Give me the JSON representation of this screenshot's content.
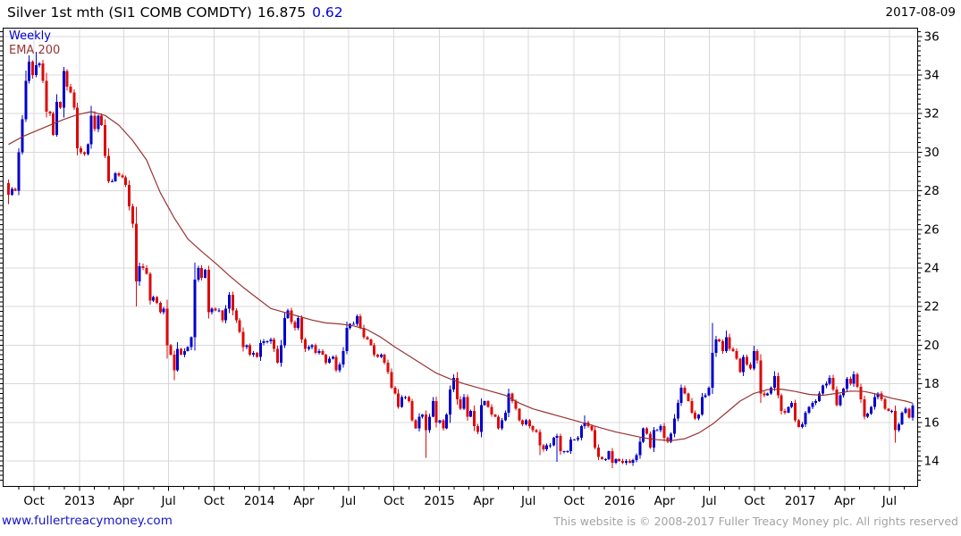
{
  "header": {
    "title": "Silver 1st mth (SI1 COMB COMDTY)",
    "price": "16.875",
    "change": "0.62",
    "date": "2017-08-09"
  },
  "legend": {
    "timeframe": "Weekly",
    "overlay": "EMA 200"
  },
  "footer": {
    "site": "www.fullertreacymoney.com",
    "copyright": "This website is © 2008-2017 Fuller Treacy Money plc. All rights reserved"
  },
  "colors": {
    "up": "#0000cc",
    "down": "#dd0a0a",
    "ema": "#993333",
    "grid": "#d8d8d8",
    "axis": "#000000",
    "text": "#000000",
    "change": "#0000dd",
    "link": "#1414cc",
    "muted": "#a3a3a3"
  },
  "chart_data": {
    "type": "candlestick",
    "timeframe": "Weekly",
    "instrument": "Silver 1st mth (SI1 COMB COMDTY)",
    "overlay": "EMA 200",
    "last": 16.875,
    "change": 0.62,
    "date": "2017-08-09",
    "ylim": [
      12.68,
      36.43
    ],
    "y_ticks": [
      14,
      16,
      18,
      20,
      22,
      24,
      26,
      28,
      30,
      32,
      34,
      36
    ],
    "x_ticks": [
      {
        "label": "Oct",
        "week": 7.4
      },
      {
        "label": "2013",
        "week": 20.6
      },
      {
        "label": "Apr",
        "week": 33.4
      },
      {
        "label": "Jul",
        "week": 46.4
      },
      {
        "label": "Oct",
        "week": 59.6
      },
      {
        "label": "2014",
        "week": 72.7
      },
      {
        "label": "Apr",
        "week": 85.6
      },
      {
        "label": "Jul",
        "week": 98.6
      },
      {
        "label": "Oct",
        "week": 111.7
      },
      {
        "label": "2015",
        "week": 124.9
      },
      {
        "label": "Apr",
        "week": 137.7
      },
      {
        "label": "Jul",
        "week": 150.7
      },
      {
        "label": "Oct",
        "week": 163.9
      },
      {
        "label": "2016",
        "week": 177.1
      },
      {
        "label": "Apr",
        "week": 190.1
      },
      {
        "label": "Jul",
        "week": 203.1
      },
      {
        "label": "Oct",
        "week": 216.2
      },
      {
        "label": "2017",
        "week": 229.4
      },
      {
        "label": "Apr",
        "week": 242.3
      },
      {
        "label": "Jul",
        "week": 255.3
      }
    ],
    "first_open": 28.4,
    "weekly_closes": [
      27.8,
      28.1,
      28.0,
      30.0,
      31.7,
      33.7,
      34.7,
      34.0,
      34.5,
      34.6,
      33.7,
      32.1,
      32.0,
      30.9,
      32.6,
      32.3,
      34.2,
      33.4,
      33.1,
      32.3,
      30.2,
      30.0,
      29.9,
      30.4,
      31.9,
      31.2,
      31.9,
      31.4,
      29.8,
      28.5,
      28.5,
      28.9,
      28.8,
      28.7,
      28.3,
      27.2,
      26.3,
      23.3,
      24.1,
      24.0,
      23.7,
      22.3,
      22.5,
      22.2,
      21.7,
      21.9,
      20.0,
      19.5,
      18.7,
      19.8,
      19.5,
      19.7,
      19.9,
      20.4,
      23.4,
      24.0,
      23.5,
      23.9,
      21.7,
      21.9,
      21.8,
      21.8,
      21.3,
      21.9,
      22.6,
      21.8,
      21.3,
      20.7,
      19.9,
      20.0,
      19.5,
      19.6,
      19.4,
      20.1,
      20.2,
      20.2,
      20.3,
      19.8,
      19.1,
      20.0,
      21.4,
      21.8,
      21.2,
      20.9,
      21.4,
      20.3,
      19.8,
      19.9,
      20.0,
      19.6,
      19.7,
      19.5,
      19.1,
      19.3,
      19.4,
      18.7,
      19.0,
      19.7,
      20.9,
      21.1,
      21.1,
      21.5,
      20.9,
      20.4,
      20.3,
      20.0,
      19.5,
      19.4,
      19.5,
      19.1,
      18.6,
      17.8,
      17.5,
      16.8,
      17.3,
      17.3,
      17.1,
      16.1,
      15.7,
      16.3,
      16.4,
      15.6,
      16.3,
      17.1,
      16.0,
      16.1,
      15.7,
      16.4,
      17.7,
      18.3,
      17.2,
      16.7,
      17.3,
      16.3,
      16.6,
      15.8,
      15.5,
      16.9,
      17.1,
      16.8,
      16.4,
      16.3,
      15.7,
      16.1,
      16.5,
      17.5,
      17.1,
      16.7,
      16.1,
      15.9,
      16.1,
      15.8,
      15.6,
      15.5,
      14.8,
      14.6,
      14.8,
      14.8,
      15.2,
      15.3,
      14.5,
      14.5,
      14.5,
      15.1,
      15.1,
      15.2,
      15.8,
      16.0,
      15.8,
      15.6,
      14.7,
      14.2,
      14.1,
      14.1,
      14.5,
      13.9,
      14.1,
      14.0,
      13.9,
      14.0,
      13.9,
      14.05,
      14.3,
      15.0,
      15.7,
      15.4,
      14.7,
      15.6,
      15.6,
      15.8,
      15.2,
      15.0,
      15.4,
      16.2,
      17.0,
      17.8,
      17.5,
      17.1,
      16.5,
      16.2,
      16.4,
      17.3,
      17.4,
      17.8,
      19.6,
      20.3,
      20.2,
      19.7,
      20.4,
      19.8,
      19.7,
      19.3,
      18.6,
      19.4,
      19.0,
      18.8,
      19.7,
      19.2,
      17.5,
      17.4,
      17.5,
      17.8,
      18.4,
      17.4,
      16.6,
      16.5,
      16.8,
      17.0,
      16.1,
      15.75,
      15.9,
      16.5,
      16.8,
      17.0,
      17.1,
      17.5,
      17.9,
      18.0,
      18.3,
      17.7,
      16.9,
      17.4,
      17.75,
      18.25,
      18.0,
      18.5,
      17.85,
      17.2,
      16.3,
      16.45,
      16.8,
      17.3,
      17.5,
      17.2,
      16.7,
      16.6,
      16.6,
      15.6,
      15.9,
      16.5,
      16.7,
      16.25,
      16.875
    ],
    "wick_overrides": {
      "0": [
        null,
        27.3
      ],
      "8": [
        35.2,
        null
      ],
      "24": [
        32.4,
        null
      ],
      "37": [
        null,
        22.0
      ],
      "46": [
        null,
        19.3
      ],
      "48": [
        null,
        18.2
      ],
      "101": [
        21.6,
        null
      ],
      "121": [
        null,
        14.15
      ],
      "129": [
        18.5,
        null
      ],
      "145": [
        17.75,
        null
      ],
      "154": [
        null,
        14.3
      ],
      "159": [
        null,
        13.95
      ],
      "167": [
        16.35,
        null
      ],
      "175": [
        null,
        13.62
      ],
      "181": [
        null,
        13.75
      ],
      "204": [
        21.15,
        null
      ],
      "208": [
        20.75,
        null
      ],
      "222": [
        18.65,
        null
      ],
      "238": [
        18.45,
        null
      ],
      "245": [
        18.65,
        null
      ],
      "257": [
        null,
        14.95
      ]
    },
    "ema_points": [
      [
        0,
        30.4
      ],
      [
        4,
        30.8
      ],
      [
        8,
        31.1
      ],
      [
        12,
        31.4
      ],
      [
        16,
        31.7
      ],
      [
        20,
        31.95
      ],
      [
        24,
        32.1
      ],
      [
        28,
        31.9
      ],
      [
        32,
        31.4
      ],
      [
        36,
        30.6
      ],
      [
        40,
        29.6
      ],
      [
        44,
        27.9
      ],
      [
        48,
        26.6
      ],
      [
        52,
        25.5
      ],
      [
        56,
        24.85
      ],
      [
        60,
        24.25
      ],
      [
        64,
        23.6
      ],
      [
        68,
        23.0
      ],
      [
        72,
        22.45
      ],
      [
        76,
        21.9
      ],
      [
        80,
        21.7
      ],
      [
        84,
        21.5
      ],
      [
        88,
        21.3
      ],
      [
        92,
        21.15
      ],
      [
        96,
        21.1
      ],
      [
        100,
        21.0
      ],
      [
        104,
        20.8
      ],
      [
        108,
        20.4
      ],
      [
        112,
        19.9
      ],
      [
        116,
        19.45
      ],
      [
        120,
        19.0
      ],
      [
        124,
        18.55
      ],
      [
        128,
        18.25
      ],
      [
        132,
        18.0
      ],
      [
        136,
        17.8
      ],
      [
        140,
        17.6
      ],
      [
        144,
        17.4
      ],
      [
        148,
        17.0
      ],
      [
        152,
        16.7
      ],
      [
        156,
        16.5
      ],
      [
        160,
        16.3
      ],
      [
        164,
        16.1
      ],
      [
        168,
        15.9
      ],
      [
        172,
        15.7
      ],
      [
        176,
        15.5
      ],
      [
        180,
        15.35
      ],
      [
        184,
        15.2
      ],
      [
        188,
        15.1
      ],
      [
        192,
        15.05
      ],
      [
        196,
        15.15
      ],
      [
        200,
        15.45
      ],
      [
        204,
        15.9
      ],
      [
        208,
        16.5
      ],
      [
        212,
        17.1
      ],
      [
        216,
        17.5
      ],
      [
        220,
        17.7
      ],
      [
        224,
        17.72
      ],
      [
        228,
        17.6
      ],
      [
        232,
        17.45
      ],
      [
        236,
        17.4
      ],
      [
        240,
        17.5
      ],
      [
        244,
        17.62
      ],
      [
        248,
        17.6
      ],
      [
        252,
        17.45
      ],
      [
        256,
        17.25
      ],
      [
        260,
        17.1
      ],
      [
        262,
        17.0
      ]
    ]
  }
}
